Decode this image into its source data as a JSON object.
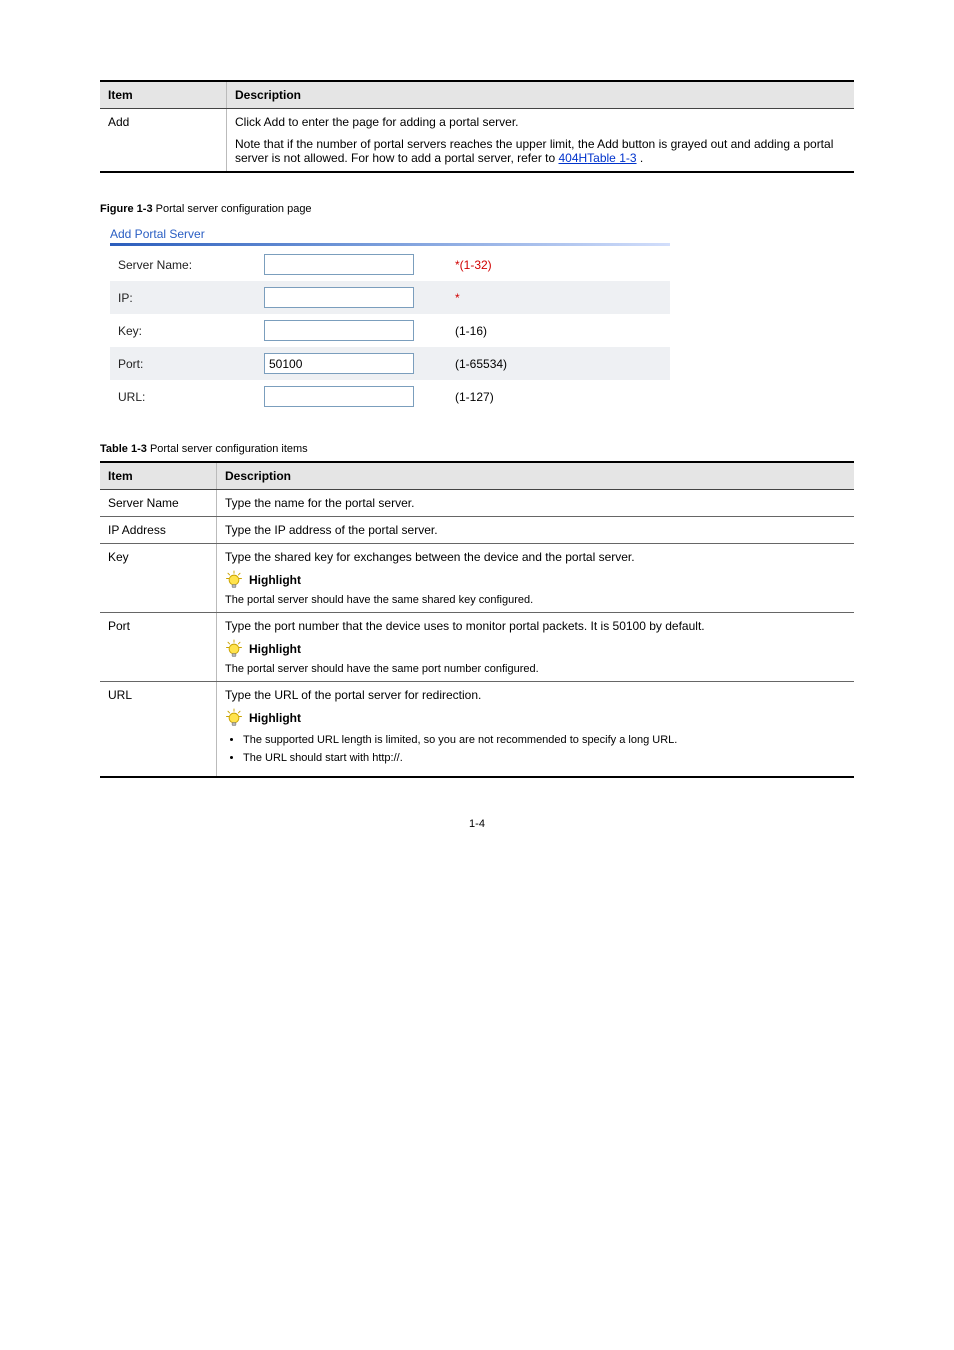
{
  "table1": {
    "head_item": "Item",
    "head_desc": "Description",
    "row_item": "Add",
    "row_desc_line1": "Click Add to enter the page for adding a portal server.",
    "row_note_prefix": "Note that if the number of portal servers reaches the upper limit, the Add button is grayed out and adding a portal server is not allowed. For how to add a portal server, refer to ",
    "row_note_link": "404H",
    "row_note_link_text": "Table 1-3",
    "row_note_suffix": "."
  },
  "figure_caption_prefix": "Figure 1-3 ",
  "figure_caption_text": "Portal server configuration page",
  "portal_form": {
    "title": "Add Portal Server",
    "rows": [
      {
        "label": "Server Name:",
        "value": "",
        "hint": "*(1-32)",
        "hint_red": true,
        "alt": false
      },
      {
        "label": "IP:",
        "value": "",
        "hint": "*",
        "hint_red": true,
        "alt": true
      },
      {
        "label": "Key:",
        "value": "",
        "hint": "(1-16)",
        "hint_red": false,
        "alt": false
      },
      {
        "label": "Port:",
        "value": "50100",
        "hint": "(1-65534)",
        "hint_red": false,
        "alt": true
      },
      {
        "label": "URL:",
        "value": "",
        "hint": "(1-127)",
        "hint_red": false,
        "alt": false
      }
    ]
  },
  "table2_caption_prefix": "Table 1-3 ",
  "table2_caption_text": "Portal server configuration items",
  "table2": {
    "head_item": "Item",
    "head_desc": "Description",
    "rows": [
      {
        "item": "Server Name",
        "desc": "Type the name for the portal server."
      },
      {
        "item": "IP Address",
        "desc": "Type the IP address of the portal server."
      },
      {
        "item": "Key",
        "desc": "Type the shared key for exchanges between the device and the portal server.",
        "highlight": "Highlight",
        "sub": "The portal server should have the same shared key configured."
      },
      {
        "item": "Port",
        "desc": "Type the port number that the device uses to monitor portal packets. It is 50100 by default.",
        "highlight": "Highlight",
        "sub": "The portal server should have the same port number configured."
      },
      {
        "item": "URL",
        "desc": "Type the URL of the portal server for redirection.",
        "highlight": "Highlight",
        "bullets": [
          "The supported URL length is limited, so you are not recommended to specify a long URL.",
          "The URL should start with http://."
        ]
      }
    ]
  },
  "page_number": "1-4"
}
